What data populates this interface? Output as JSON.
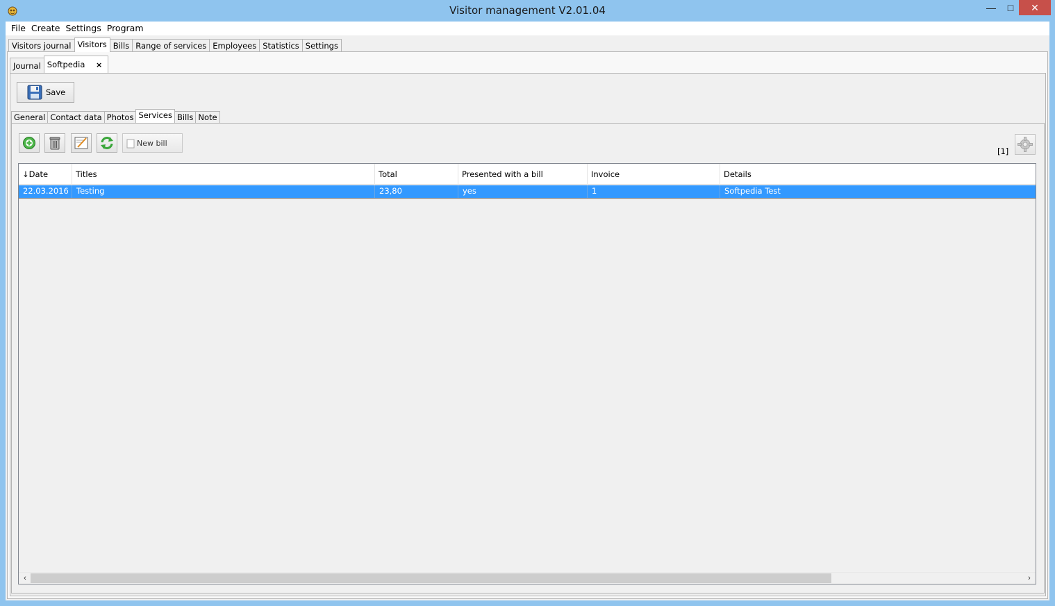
{
  "window": {
    "title": "Visitor management V2.01.04",
    "min_icon": "minimize-icon",
    "max_icon": "maximize-icon",
    "close_icon": "close-icon",
    "close_color": "#c7504a"
  },
  "menu": [
    "File",
    "Create",
    "Settings",
    "Program"
  ],
  "main_tabs": [
    {
      "label": "Visitors journal",
      "active": false
    },
    {
      "label": "Visitors",
      "active": true
    },
    {
      "label": "Bills",
      "active": false
    },
    {
      "label": "Range of services",
      "active": false
    },
    {
      "label": "Employees",
      "active": false
    },
    {
      "label": "Statistics",
      "active": false
    },
    {
      "label": "Settings",
      "active": false
    }
  ],
  "sub_tabs": [
    {
      "label": "Journal",
      "active": false
    },
    {
      "label": "Softpedia",
      "active": true,
      "closable": true,
      "close_glyph": "×"
    }
  ],
  "toolbar": {
    "save_label": "Save",
    "save_icon": "floppy-disk-icon"
  },
  "detail_tabs": [
    {
      "label": "General",
      "active": false
    },
    {
      "label": "Contact data",
      "active": false
    },
    {
      "label": "Photos",
      "active": false
    },
    {
      "label": "Services",
      "active": true
    },
    {
      "label": "Bills",
      "active": false
    },
    {
      "label": "Note",
      "active": false
    }
  ],
  "services_toolbar": {
    "buttons": [
      "add-icon",
      "trash-icon",
      "edit-icon",
      "refresh-icon"
    ],
    "new_bill_label": "New bill",
    "page_indicator": "[1]",
    "settings_icon": "gear-icon"
  },
  "table": {
    "sort_glyph": "↓",
    "columns": [
      "Date",
      "Titles",
      "Total",
      "Presented with a bill",
      "Invoice",
      "Details"
    ],
    "rows": [
      {
        "date": "22.03.2016",
        "titles": "Testing",
        "total": "23,80",
        "presented": "yes",
        "invoice": "1",
        "details": "Softpedia Test",
        "selected": true
      }
    ],
    "selection_color": "#3399ff"
  },
  "scrollbar": {
    "left_arrow": "‹",
    "right_arrow": "›"
  }
}
